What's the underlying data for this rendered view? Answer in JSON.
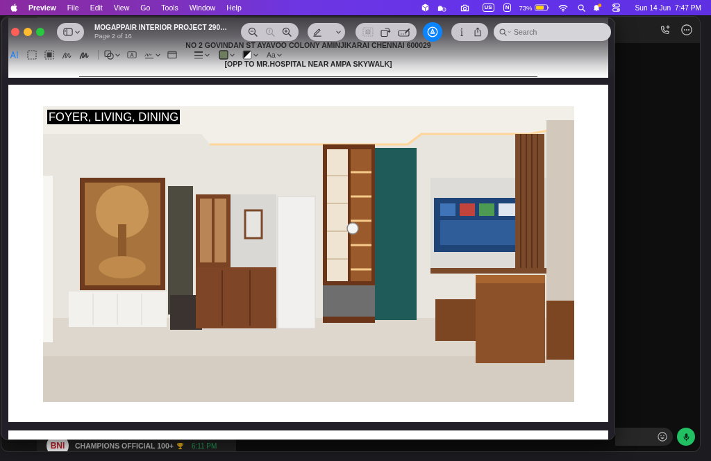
{
  "menu_bar": {
    "app_name": "Preview",
    "menus": [
      "File",
      "Edit",
      "View",
      "Go",
      "Tools",
      "Window",
      "Help"
    ],
    "input_source": "US",
    "app_badge": "N",
    "battery": "73%",
    "date": "Sun 14 Jun",
    "time": "7:47 PM"
  },
  "preview_window": {
    "title": "MOGAPPAIR INTERIOR PROJECT 290…",
    "subtitle": "Page 2 of 16",
    "zoom_buttons": [
      {
        "disabled": false
      },
      {
        "disabled": true
      },
      {
        "disabled": false
      }
    ],
    "edit_tools": [
      {
        "disabled": true
      },
      {
        "disabled": false
      },
      {
        "disabled": false
      }
    ],
    "markup_button": {
      "selected": true
    },
    "search": {
      "placeholder": "Search"
    },
    "markup_tools": [
      {
        "selected": true
      },
      {
        "selected": false
      },
      {
        "selected": false
      },
      {
        "selected": false
      },
      {
        "selected": false
      }
    ],
    "font_button": "Aa",
    "pages": [
      {
        "kind": "header",
        "address_lines": [
          "NO 2 GOVINDAN ST AYAVOO COLONY AMINJIKARAI CHENNAI 600029",
          "[OPP TO MR.HOSPITAL NEAR AMPA SKYWALK]"
        ]
      },
      {
        "kind": "render",
        "caption": "FOYER, LIVING, DINING"
      },
      {
        "kind": "blank"
      }
    ]
  },
  "chat_window": {
    "chat": {
      "avatar_text": "BNI",
      "name": "CHAMPIONS OFFICIAL 100+",
      "time": "6:11 PM",
      "unread": true
    }
  }
}
